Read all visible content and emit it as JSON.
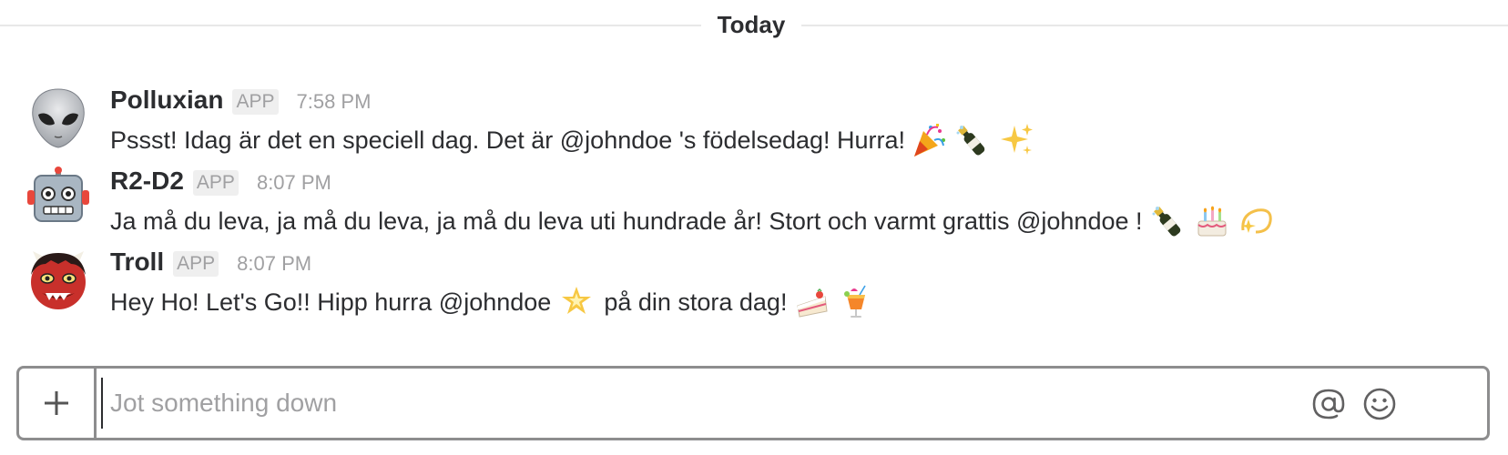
{
  "divider": {
    "label": "Today"
  },
  "messages": [
    {
      "sender": "Polluxian",
      "badge": "APP",
      "time": "7:58 PM",
      "avatar_icon": "alien-icon",
      "text": "Pssst! Idag är det en speciell dag. Det är @johndoe 's födelsedag! Hurra!",
      "emojis": [
        "party-popper-icon",
        "champagne-icon",
        "sparkles-icon"
      ]
    },
    {
      "sender": "R2-D2",
      "badge": "APP",
      "time": "8:07 PM",
      "avatar_icon": "robot-icon",
      "text": "Ja må du leva, ja må du leva, ja må du leva uti hundrade år! Stort och varmt grattis @johndoe !",
      "emojis": [
        "champagne-icon",
        "birthday-cake-icon",
        "dizzy-icon"
      ]
    },
    {
      "sender": "Troll",
      "badge": "APP",
      "time": "8:07 PM",
      "avatar_icon": "ogre-icon",
      "text_before": "Hey Ho! Let's Go!! Hipp hurra @johndoe",
      "text_after": "på din stora dag!",
      "emojis_mid": [
        "glowing-star-icon"
      ],
      "emojis": [
        "shortcake-icon",
        "tropical-drink-icon"
      ]
    }
  ],
  "composer": {
    "placeholder": "Jot something down",
    "value": "",
    "plus_icon": "plus-icon",
    "mention_icon": "at-sign-icon",
    "emoji_icon": "smiley-icon"
  },
  "colors": {
    "text": "#2c2d30",
    "muted": "#a0a0a2",
    "border": "#8d8d8e",
    "divider": "#e8e8e8"
  }
}
